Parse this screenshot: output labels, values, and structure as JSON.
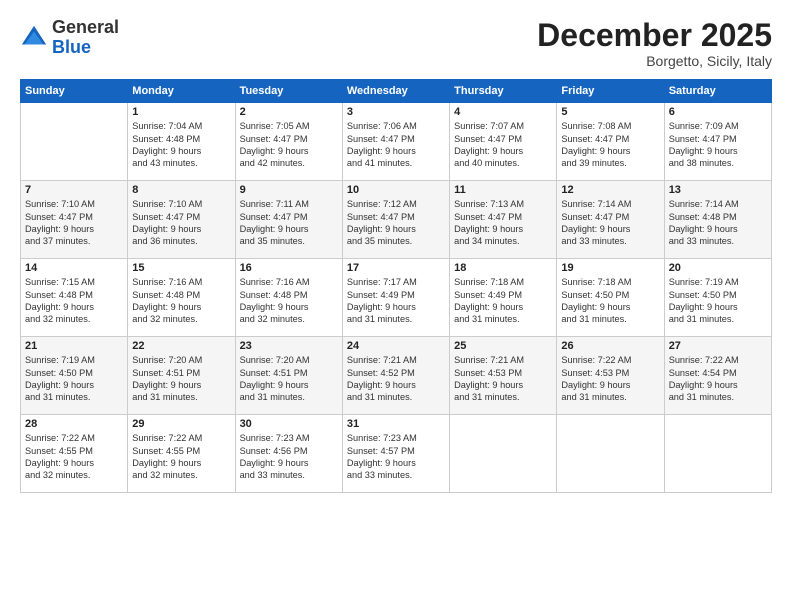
{
  "header": {
    "logo_general": "General",
    "logo_blue": "Blue",
    "month_title": "December 2025",
    "location": "Borgetto, Sicily, Italy"
  },
  "days_of_week": [
    "Sunday",
    "Monday",
    "Tuesday",
    "Wednesday",
    "Thursday",
    "Friday",
    "Saturday"
  ],
  "weeks": [
    [
      {
        "day": "",
        "detail": ""
      },
      {
        "day": "1",
        "detail": "Sunrise: 7:04 AM\nSunset: 4:48 PM\nDaylight: 9 hours\nand 43 minutes."
      },
      {
        "day": "2",
        "detail": "Sunrise: 7:05 AM\nSunset: 4:47 PM\nDaylight: 9 hours\nand 42 minutes."
      },
      {
        "day": "3",
        "detail": "Sunrise: 7:06 AM\nSunset: 4:47 PM\nDaylight: 9 hours\nand 41 minutes."
      },
      {
        "day": "4",
        "detail": "Sunrise: 7:07 AM\nSunset: 4:47 PM\nDaylight: 9 hours\nand 40 minutes."
      },
      {
        "day": "5",
        "detail": "Sunrise: 7:08 AM\nSunset: 4:47 PM\nDaylight: 9 hours\nand 39 minutes."
      },
      {
        "day": "6",
        "detail": "Sunrise: 7:09 AM\nSunset: 4:47 PM\nDaylight: 9 hours\nand 38 minutes."
      }
    ],
    [
      {
        "day": "7",
        "detail": "Sunrise: 7:10 AM\nSunset: 4:47 PM\nDaylight: 9 hours\nand 37 minutes."
      },
      {
        "day": "8",
        "detail": "Sunrise: 7:10 AM\nSunset: 4:47 PM\nDaylight: 9 hours\nand 36 minutes."
      },
      {
        "day": "9",
        "detail": "Sunrise: 7:11 AM\nSunset: 4:47 PM\nDaylight: 9 hours\nand 35 minutes."
      },
      {
        "day": "10",
        "detail": "Sunrise: 7:12 AM\nSunset: 4:47 PM\nDaylight: 9 hours\nand 35 minutes."
      },
      {
        "day": "11",
        "detail": "Sunrise: 7:13 AM\nSunset: 4:47 PM\nDaylight: 9 hours\nand 34 minutes."
      },
      {
        "day": "12",
        "detail": "Sunrise: 7:14 AM\nSunset: 4:47 PM\nDaylight: 9 hours\nand 33 minutes."
      },
      {
        "day": "13",
        "detail": "Sunrise: 7:14 AM\nSunset: 4:48 PM\nDaylight: 9 hours\nand 33 minutes."
      }
    ],
    [
      {
        "day": "14",
        "detail": "Sunrise: 7:15 AM\nSunset: 4:48 PM\nDaylight: 9 hours\nand 32 minutes."
      },
      {
        "day": "15",
        "detail": "Sunrise: 7:16 AM\nSunset: 4:48 PM\nDaylight: 9 hours\nand 32 minutes."
      },
      {
        "day": "16",
        "detail": "Sunrise: 7:16 AM\nSunset: 4:48 PM\nDaylight: 9 hours\nand 32 minutes."
      },
      {
        "day": "17",
        "detail": "Sunrise: 7:17 AM\nSunset: 4:49 PM\nDaylight: 9 hours\nand 31 minutes."
      },
      {
        "day": "18",
        "detail": "Sunrise: 7:18 AM\nSunset: 4:49 PM\nDaylight: 9 hours\nand 31 minutes."
      },
      {
        "day": "19",
        "detail": "Sunrise: 7:18 AM\nSunset: 4:50 PM\nDaylight: 9 hours\nand 31 minutes."
      },
      {
        "day": "20",
        "detail": "Sunrise: 7:19 AM\nSunset: 4:50 PM\nDaylight: 9 hours\nand 31 minutes."
      }
    ],
    [
      {
        "day": "21",
        "detail": "Sunrise: 7:19 AM\nSunset: 4:50 PM\nDaylight: 9 hours\nand 31 minutes."
      },
      {
        "day": "22",
        "detail": "Sunrise: 7:20 AM\nSunset: 4:51 PM\nDaylight: 9 hours\nand 31 minutes."
      },
      {
        "day": "23",
        "detail": "Sunrise: 7:20 AM\nSunset: 4:51 PM\nDaylight: 9 hours\nand 31 minutes."
      },
      {
        "day": "24",
        "detail": "Sunrise: 7:21 AM\nSunset: 4:52 PM\nDaylight: 9 hours\nand 31 minutes."
      },
      {
        "day": "25",
        "detail": "Sunrise: 7:21 AM\nSunset: 4:53 PM\nDaylight: 9 hours\nand 31 minutes."
      },
      {
        "day": "26",
        "detail": "Sunrise: 7:22 AM\nSunset: 4:53 PM\nDaylight: 9 hours\nand 31 minutes."
      },
      {
        "day": "27",
        "detail": "Sunrise: 7:22 AM\nSunset: 4:54 PM\nDaylight: 9 hours\nand 31 minutes."
      }
    ],
    [
      {
        "day": "28",
        "detail": "Sunrise: 7:22 AM\nSunset: 4:55 PM\nDaylight: 9 hours\nand 32 minutes."
      },
      {
        "day": "29",
        "detail": "Sunrise: 7:22 AM\nSunset: 4:55 PM\nDaylight: 9 hours\nand 32 minutes."
      },
      {
        "day": "30",
        "detail": "Sunrise: 7:23 AM\nSunset: 4:56 PM\nDaylight: 9 hours\nand 33 minutes."
      },
      {
        "day": "31",
        "detail": "Sunrise: 7:23 AM\nSunset: 4:57 PM\nDaylight: 9 hours\nand 33 minutes."
      },
      {
        "day": "",
        "detail": ""
      },
      {
        "day": "",
        "detail": ""
      },
      {
        "day": "",
        "detail": ""
      }
    ]
  ]
}
